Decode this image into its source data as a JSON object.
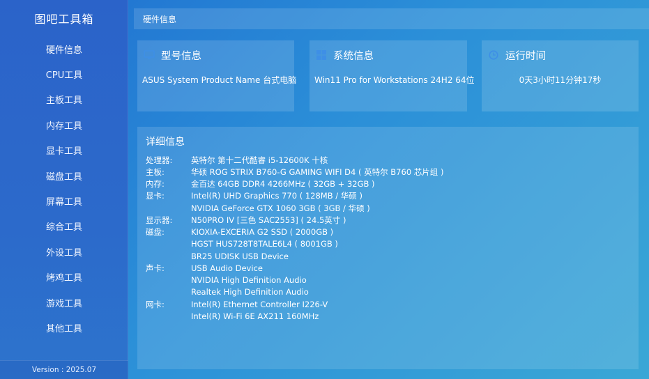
{
  "app": {
    "title": "图吧工具箱",
    "version": "Version : 2025.07"
  },
  "sidebar": {
    "items": [
      {
        "label": "硬件信息"
      },
      {
        "label": "CPU工具"
      },
      {
        "label": "主板工具"
      },
      {
        "label": "内存工具"
      },
      {
        "label": "显卡工具"
      },
      {
        "label": "磁盘工具"
      },
      {
        "label": "屏幕工具"
      },
      {
        "label": "综合工具"
      },
      {
        "label": "外设工具"
      },
      {
        "label": "烤鸡工具"
      },
      {
        "label": "游戏工具"
      },
      {
        "label": "其他工具"
      }
    ]
  },
  "titlebar": {
    "title": "硬件信息",
    "controls": {
      "menu": "≡",
      "minimize": "-",
      "close": "×"
    }
  },
  "cards": {
    "model": {
      "icon": "monitor-icon",
      "title": "型号信息",
      "value": "ASUS System Product Name 台式电脑"
    },
    "system": {
      "icon": "windows-icon",
      "title": "系统信息",
      "value": "Win11 Pro for Workstations 24H2 64位"
    },
    "uptime": {
      "icon": "clock-icon",
      "title": "运行时间",
      "value": "0天3小时11分钟17秒"
    }
  },
  "detail": {
    "title": "详细信息",
    "rows": [
      {
        "key": "处理器:",
        "value": "英特尔 第十二代酷睿 i5-12600K 十核"
      },
      {
        "key": "主板:",
        "value": "华硕 ROG STRIX B760-G GAMING WIFI D4 ( 英特尔 B760 芯片组 )"
      },
      {
        "key": "内存:",
        "value": "金百达 64GB DDR4 4266MHz ( 32GB + 32GB )"
      },
      {
        "key": "显卡:",
        "value": "Intel(R) UHD Graphics 770 ( 128MB / 华硕 )"
      },
      {
        "key": "",
        "value": "NVIDIA GeForce GTX 1060 3GB ( 3GB / 华硕 )"
      },
      {
        "key": "显示器:",
        "value": "N50PRO IV [三色 SAC2553] ( 24.5英寸 )"
      },
      {
        "key": "磁盘:",
        "value": "KIOXIA-EXCERIA G2 SSD ( 2000GB )"
      },
      {
        "key": "",
        "value": "HGST HUS728T8TALE6L4 ( 8001GB )"
      },
      {
        "key": "",
        "value": "BR25 UDISK USB Device"
      },
      {
        "key": "声卡:",
        "value": "USB Audio Device"
      },
      {
        "key": "",
        "value": "NVIDIA High Definition Audio"
      },
      {
        "key": "",
        "value": "Realtek High Definition Audio"
      },
      {
        "key": "网卡:",
        "value": "Intel(R) Ethernet Controller I226-V"
      },
      {
        "key": "",
        "value": "Intel(R) Wi-Fi 6E AX211 160MHz"
      }
    ]
  },
  "colors": {
    "accent": "#2b63c9",
    "background_end": "#3aa7d6",
    "text": "#ffffff"
  }
}
